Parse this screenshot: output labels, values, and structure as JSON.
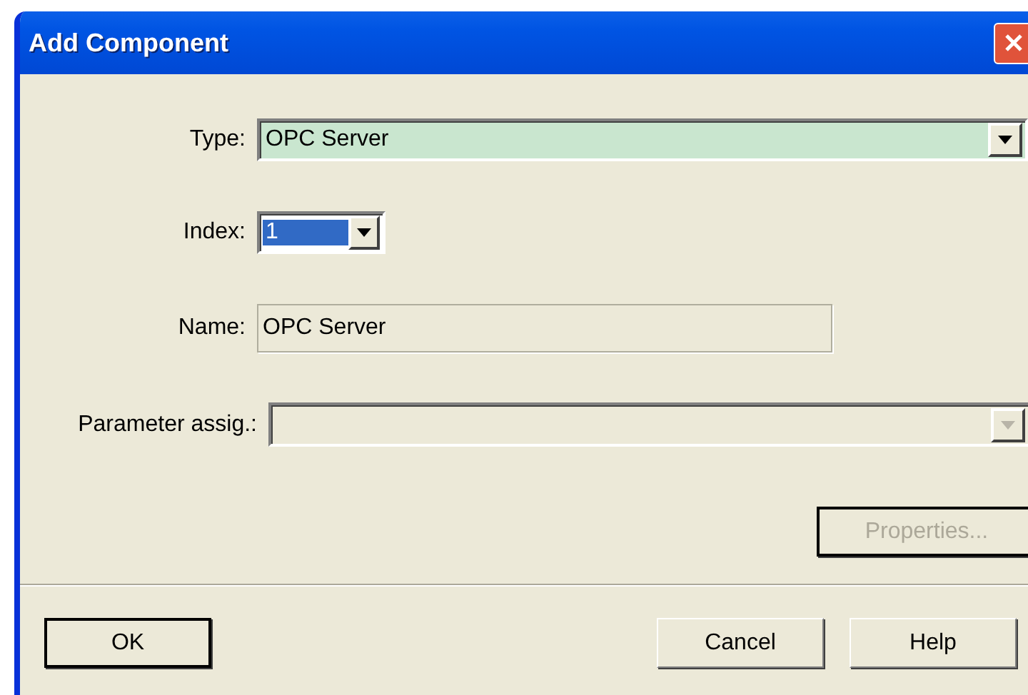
{
  "window": {
    "title": "Add Component"
  },
  "fields": [
    {
      "kind": "combo",
      "label": "Type:",
      "value": "OPC Server",
      "disabled": false
    },
    {
      "kind": "small_combo",
      "label": "Index:",
      "value": "1",
      "disabled": false
    },
    {
      "kind": "text",
      "label": "Name:",
      "value": "OPC Server",
      "disabled": true
    },
    {
      "kind": "combo",
      "label": "Parameter assig.:",
      "disabled": true
    }
  ],
  "properties_button": {
    "label": "Properties...",
    "disabled": true
  },
  "buttons": [
    {
      "label": "OK",
      "default": true
    },
    {
      "label": "Cancel",
      "default": false
    },
    {
      "label": "Help",
      "default": false
    }
  ]
}
